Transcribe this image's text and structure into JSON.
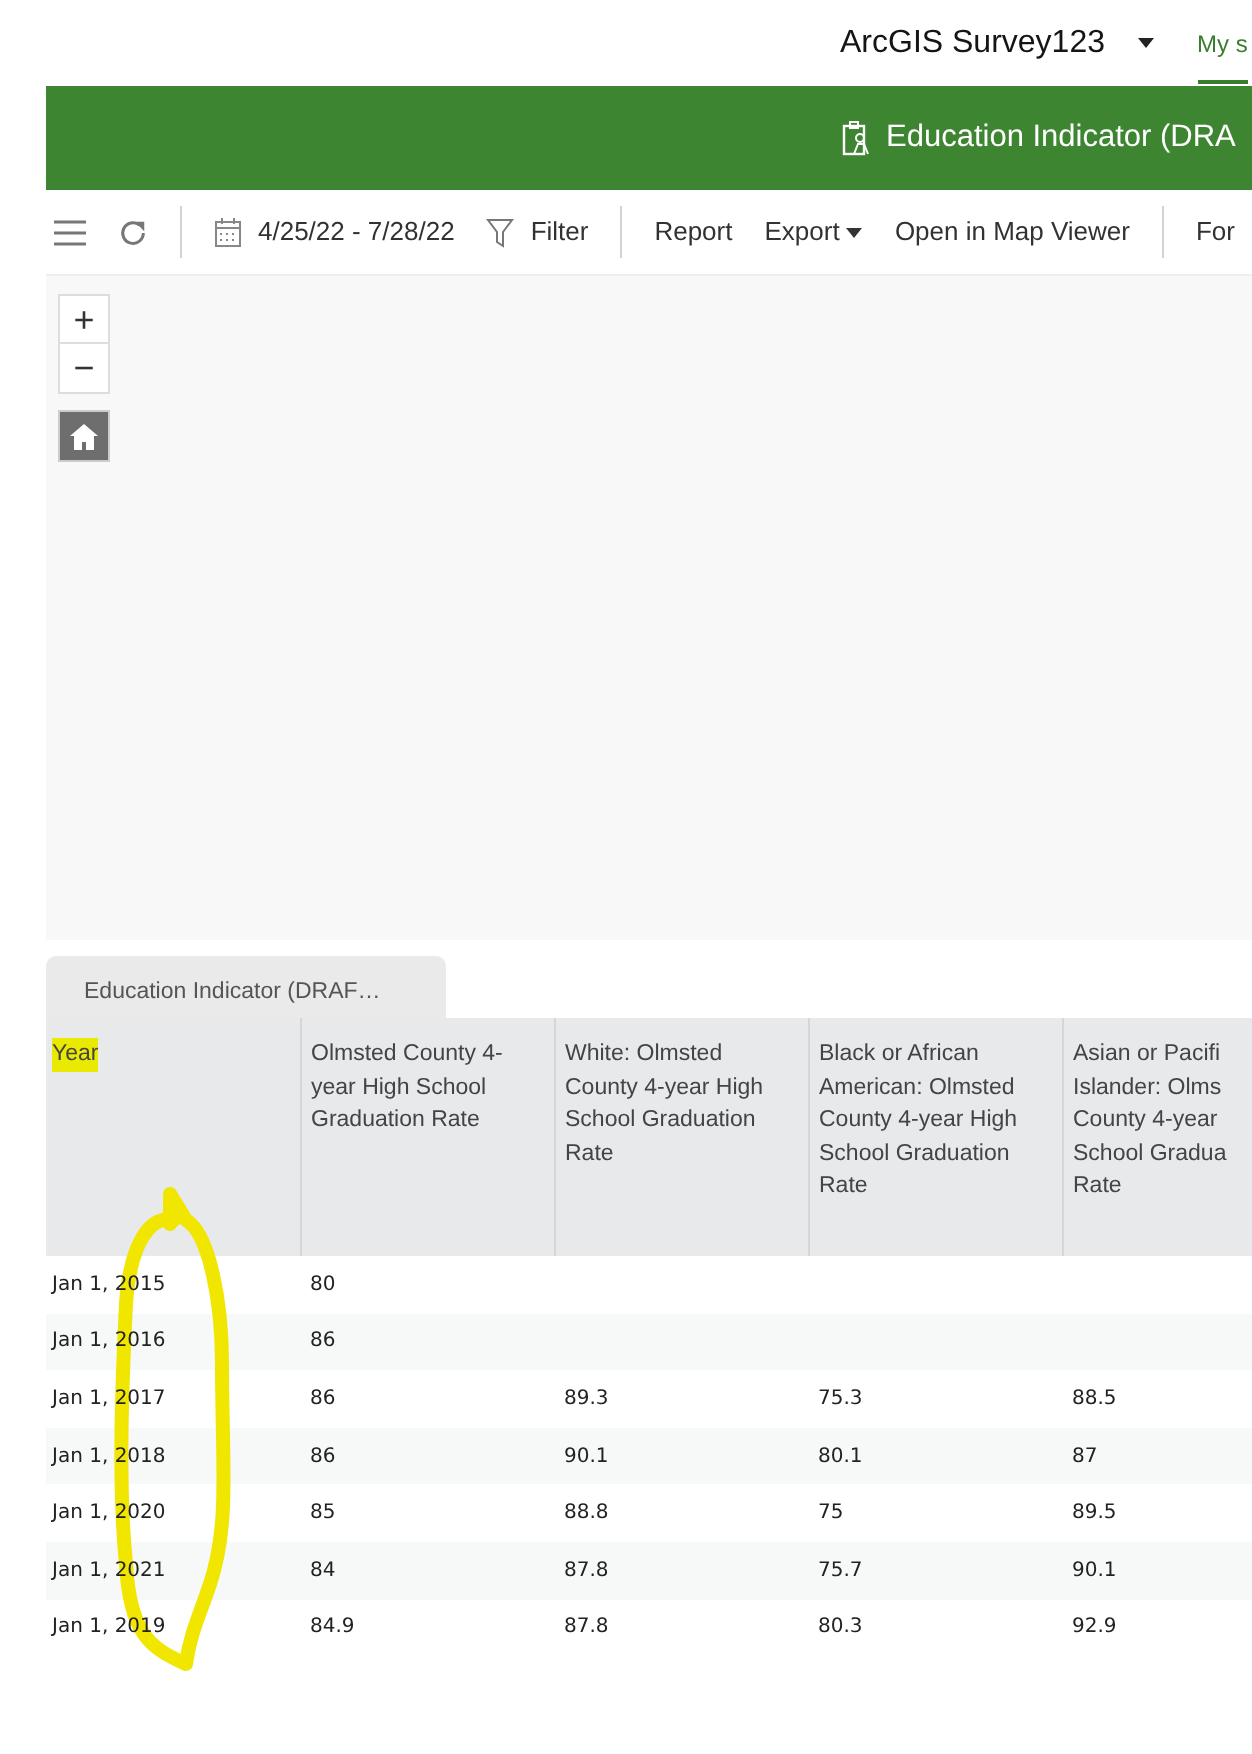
{
  "top_bar": {
    "app_name": "ArcGIS Survey123",
    "nav_items": [
      {
        "label": "My s",
        "selected": true
      }
    ]
  },
  "header": {
    "title": "Education Indicator (DRA"
  },
  "toolbar": {
    "date_range": "4/25/22 - 7/28/22",
    "filter": "Filter",
    "items": [
      {
        "label": "Report",
        "kind": "link"
      },
      {
        "label": "Export",
        "kind": "dropdown"
      },
      {
        "label": "Open in Map Viewer",
        "kind": "link"
      },
      {
        "label": "For",
        "kind": "section-link"
      }
    ]
  },
  "map": {
    "zoom_in": "+",
    "zoom_out": "−"
  },
  "table_tab": {
    "label": "Education Indicator (DRAF…"
  },
  "table": {
    "columns": [
      {
        "label": "Year",
        "highlighted": true
      },
      {
        "label": "Olmsted County 4-year High School Graduation Rate",
        "highlighted": false
      },
      {
        "label": "White: Olmsted County 4-year High School Graduation Rate",
        "highlighted": false
      },
      {
        "label": "Black or African American: Olmsted County 4-year High School Graduation Rate",
        "highlighted": false
      },
      {
        "label": "Asian or Pacifi Islander: Olms County 4-year School Gradua Rate",
        "highlighted": false
      }
    ],
    "rows": [
      [
        "Jan 1, 2015",
        "80",
        "",
        "",
        ""
      ],
      [
        "Jan 1, 2016",
        "86",
        "",
        "",
        ""
      ],
      [
        "Jan 1, 2017",
        "86",
        "89.3",
        "75.3",
        "88.5"
      ],
      [
        "Jan 1, 2018",
        "86",
        "90.1",
        "80.1",
        "87"
      ],
      [
        "Jan 1, 2020",
        "85",
        "88.8",
        "75",
        "89.5"
      ],
      [
        "Jan 1, 2021",
        "84",
        "87.8",
        "75.7",
        "90.1"
      ],
      [
        "Jan 1, 2019",
        "84.9",
        "87.8",
        "80.3",
        "92.9"
      ]
    ]
  }
}
